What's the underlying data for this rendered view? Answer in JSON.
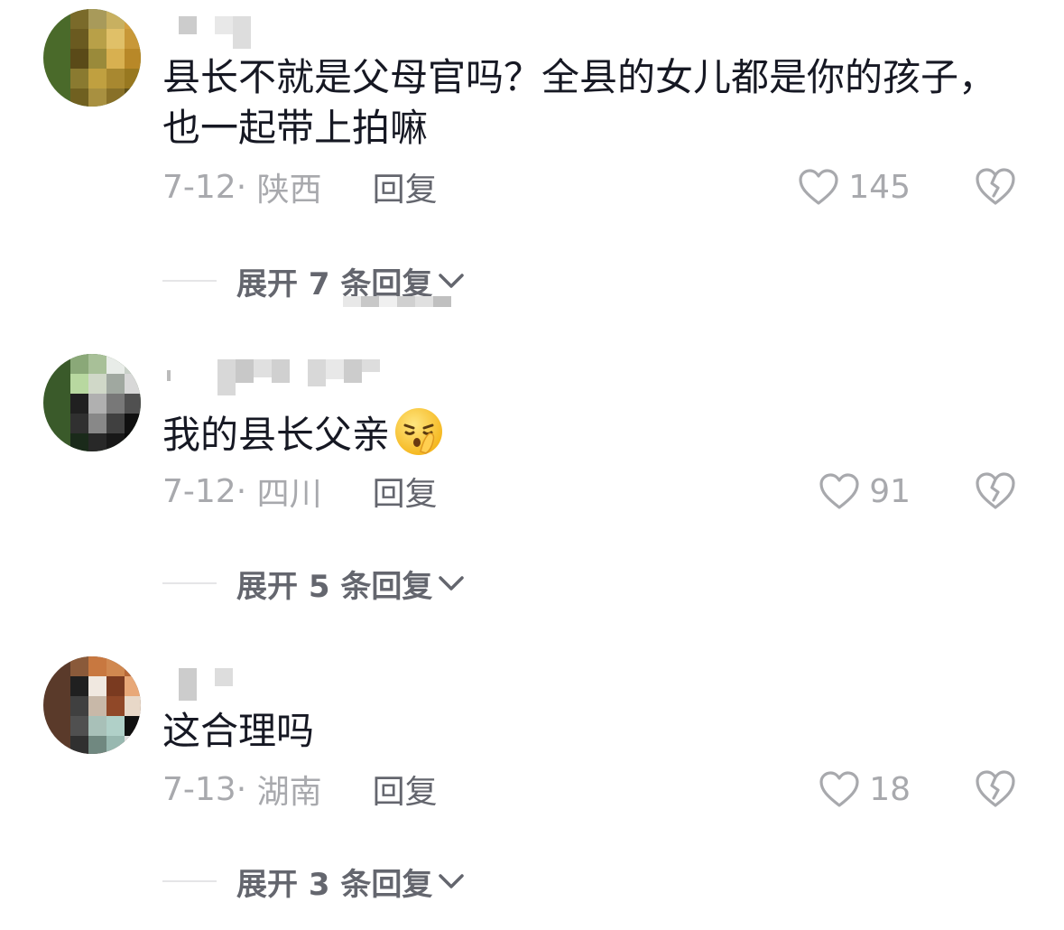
{
  "comments": [
    {
      "text": "县长不就是父母官吗？全县的女儿都是你的孩子，也一起带上拍嘛",
      "date": "7-12",
      "location": "陕西",
      "reply_label": "回复",
      "likes": "145",
      "expand_label": "展开 7 条回复",
      "avatar_colors": [
        "#7a6a2a",
        "#a89a5a",
        "#c8b060",
        "#d4a040",
        "#6a5a20",
        "#b8a048",
        "#e0c068",
        "#c89838",
        "#5a4a18",
        "#9a8a3a",
        "#d8b050",
        "#b88828",
        "#8a7a30",
        "#c0a040",
        "#a88830",
        "#987820",
        "#706020",
        "#a89040",
        "#887028",
        "#605018"
      ]
    },
    {
      "text": "我的县长父亲",
      "date": "7-12",
      "location": "四川",
      "reply_label": "回复",
      "likes": "91",
      "expand_label": "展开 5 条回复",
      "avatar_colors": [
        "#8aa878",
        "#a8c098",
        "#e8ece8",
        "#c8d0c8",
        "#b8d8a0",
        "#d0d8c8",
        "#a0a8a0",
        "#d8d8d8",
        "#202020",
        "#b0b0b0",
        "#787878",
        "#505050",
        "#303030",
        "#888888",
        "#404040",
        "#101010",
        "#1a2a1a",
        "#282828",
        "#181818",
        "#0a0a0a"
      ]
    },
    {
      "text": "这合理吗",
      "date": "7-13",
      "location": "湖南",
      "reply_label": "回复",
      "likes": "18",
      "expand_label": "展开 3 条回复",
      "avatar_colors": [
        "#8a5a3a",
        "#c87840",
        "#d08850",
        "#b86838",
        "#202020",
        "#f0e8e0",
        "#7a3a20",
        "#e8a878",
        "#404040",
        "#c8b8a8",
        "#904828",
        "#e8d8c8",
        "#505050",
        "#a8c0b8",
        "#b0d0c8",
        "#101010",
        "#303030",
        "#708880",
        "#98b8b0",
        "#e0e0e0"
      ]
    }
  ],
  "colors": {
    "text_primary": "#161823",
    "text_secondary": "#a8a9ad",
    "reply": "#64666e",
    "icon": "#a8a9ad"
  }
}
